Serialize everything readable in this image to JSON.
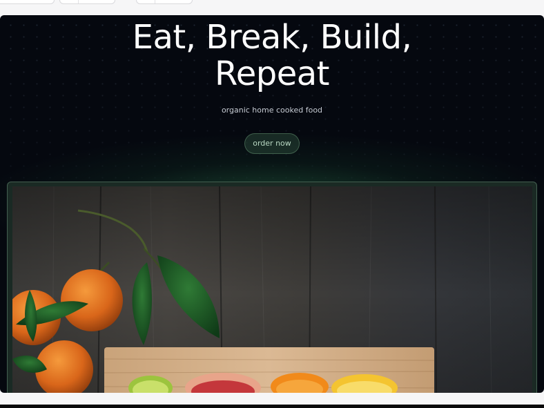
{
  "hero": {
    "title_line1": "Eat, Break, Build,",
    "title_line2": "Repeat",
    "subtitle": "organic home cooked food",
    "cta_label": "order now"
  },
  "image": {
    "subject": "oranges and citrus halves on wooden board over dark wood table"
  },
  "colors": {
    "background": "#05080f",
    "accent_green": "#2a6e46",
    "title_text": "#ffffff"
  }
}
